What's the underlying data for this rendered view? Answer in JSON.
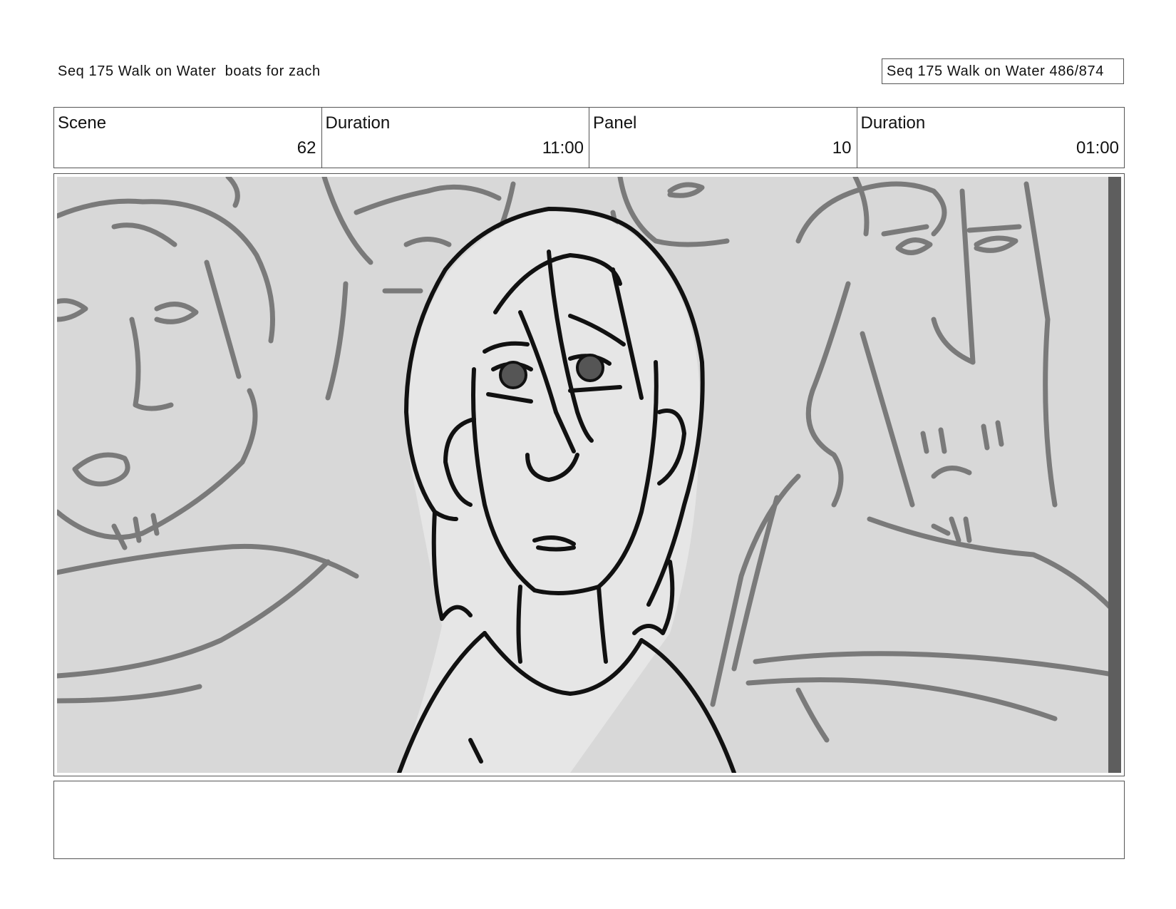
{
  "header": {
    "title": "Seq 175 Walk on Water  boats for zach",
    "page_counter": "Seq 175 Walk on Water 486/874"
  },
  "info": [
    {
      "label": "Scene",
      "value": "62"
    },
    {
      "label": "Duration",
      "value": "11:00"
    },
    {
      "label": "Panel",
      "value": "10"
    },
    {
      "label": "Duration",
      "value": "01:00"
    }
  ],
  "notes": {
    "text": ""
  },
  "colors": {
    "panel_background": "#d8d8d8",
    "foreground_sketch": "#111111",
    "background_sketch": "#7a7a7a"
  }
}
